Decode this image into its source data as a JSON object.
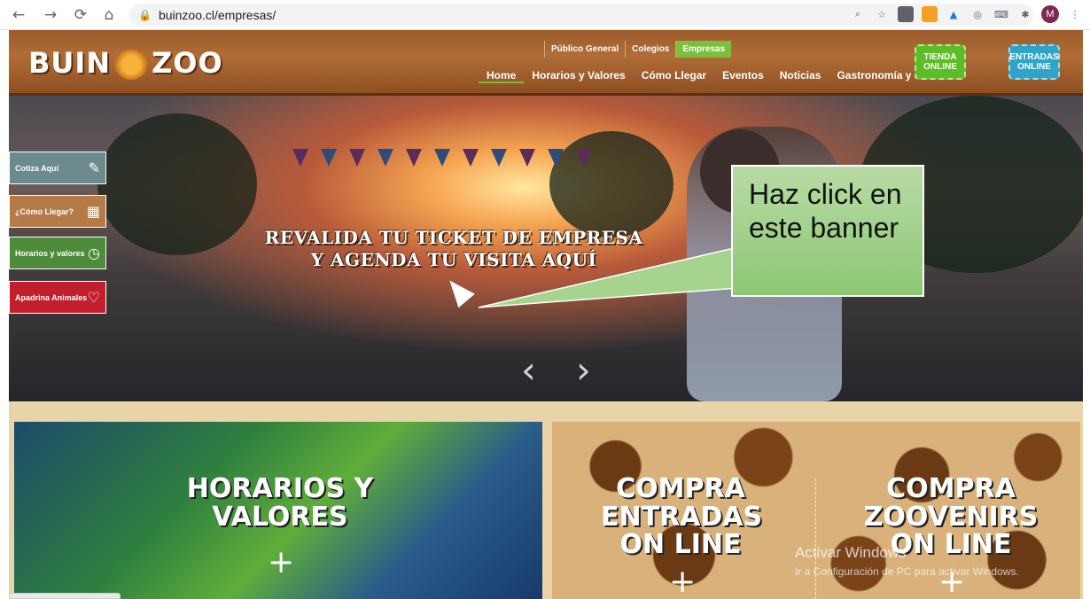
{
  "browser": {
    "url": "buinzoo.cl/empresas/",
    "avatar_letter": "M",
    "back_icon": "←",
    "forward_icon": "→",
    "reload_icon": "⟳",
    "home_icon": "⌂"
  },
  "header": {
    "logo_left": "BUIN",
    "logo_right": "ZOO",
    "audience_tabs": [
      "Público General",
      "Colegios",
      "Empresas"
    ],
    "nav_items": [
      "Home",
      "Horarios y Valores",
      "Cómo Llegar",
      "Eventos",
      "Noticias",
      "Gastronomía y Servicios"
    ],
    "tienda_line1": "TIENDA",
    "tienda_line2": "ONLINE",
    "entradas_line1": "ENTRADAS",
    "entradas_line2": "ONLINE",
    "colors": {
      "active_green": "#7cbf3b",
      "tienda": "#5cbd26",
      "entradas": "#2ea4c9"
    }
  },
  "hero": {
    "banner_line1": "Revalida tu ticket de empresa",
    "banner_line2": "y agenda tu visita aquí",
    "callout": "Haz click en este banner",
    "prev_icon": "‹",
    "next_icon": "›"
  },
  "side_buttons": [
    {
      "label": "Cotiza Aquí",
      "icon": "ticket-icon"
    },
    {
      "label": "¿Cómo Llegar?",
      "icon": "map-icon"
    },
    {
      "label": "Horarios y valores",
      "icon": "clock-icon"
    },
    {
      "label": "Apadrina Animales",
      "icon": "heart-icon"
    }
  ],
  "tiles": {
    "horarios": "HORARIOS Y VALORES",
    "entradas": "COMPRA ENTRADAS ON LINE",
    "zoovenirs": "COMPRA ZOOVENIRS ON LINE",
    "plus": "+"
  },
  "watermark": {
    "line1": "Activar Windows",
    "line2": "Ir a Configuración de PC para activar Windows."
  }
}
